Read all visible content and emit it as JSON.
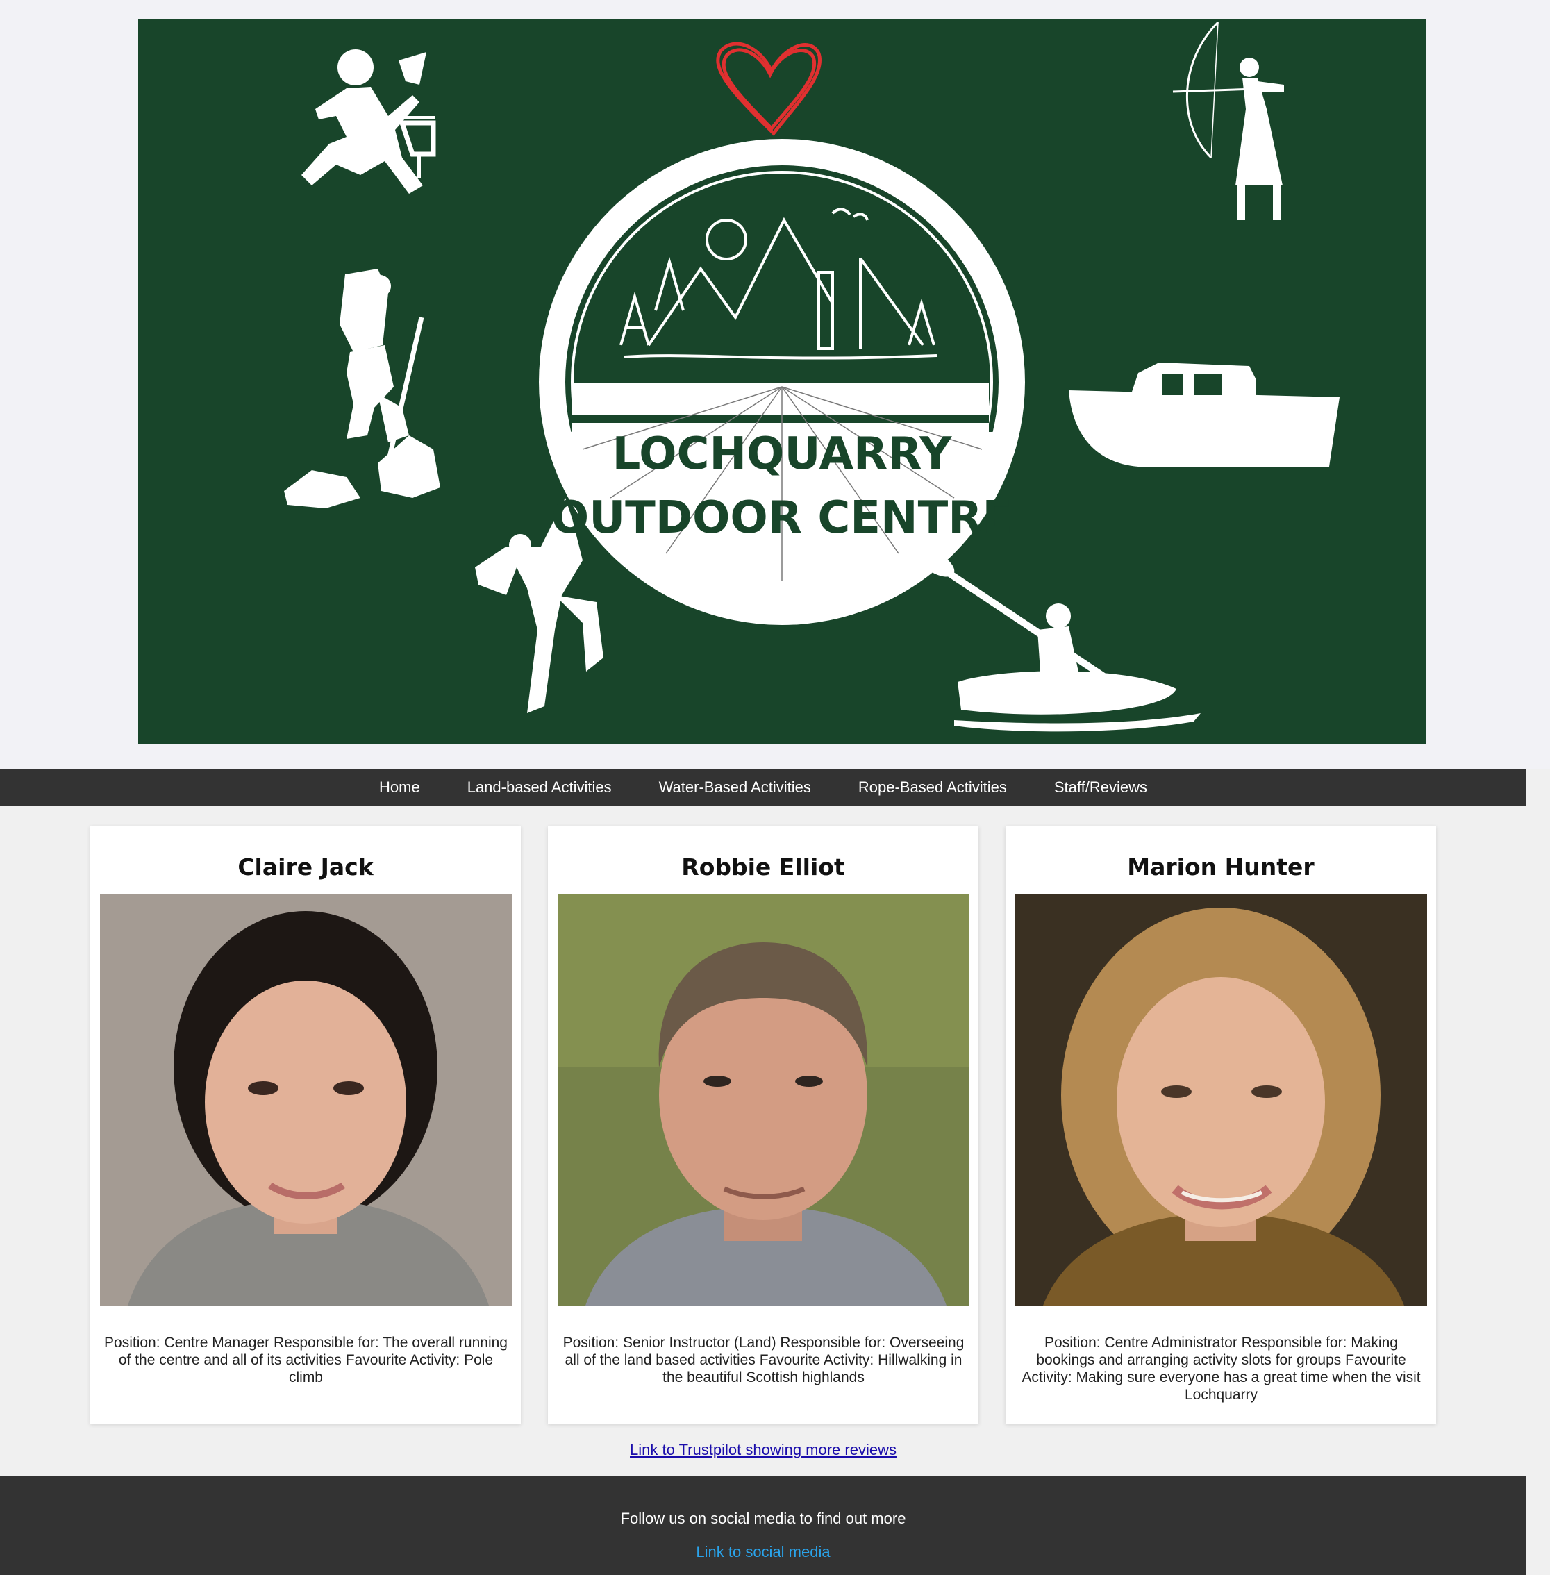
{
  "banner": {
    "logo_line1": "LOCHQUARRY",
    "logo_line2": "OUTDOOR CENTRE",
    "colors": {
      "background": "#18452a",
      "heart": "#e03030",
      "ink": "#ffffff"
    }
  },
  "nav": {
    "items": [
      {
        "label": "Home"
      },
      {
        "label": "Land-based Activities"
      },
      {
        "label": "Water-Based Activities"
      },
      {
        "label": "Rope-Based Activities"
      },
      {
        "label": "Staff/Reviews"
      }
    ]
  },
  "staff": [
    {
      "name": "Claire Jack",
      "description": "Position: Centre Manager Responsible for: The overall running of the centre and all of its activities Favourite Activity: Pole climb",
      "photo_bg": "#a49b93",
      "hair": "#1d1714"
    },
    {
      "name": "Robbie Elliot",
      "description": "Position: Senior Instructor (Land) Responsible for: Overseeing all of the land based activities Favourite Activity: Hillwalking in the beautiful Scottish highlands",
      "photo_bg": "#76824a",
      "hair": "#6b5a48"
    },
    {
      "name": "Marion Hunter",
      "description": "Position: Centre Administrator Responsible for: Making bookings and arranging activity slots for groups Favourite Activity: Making sure everyone has a great time when the visit Lochquarry",
      "photo_bg": "#3a3022",
      "hair": "#b48a52"
    }
  ],
  "trustpilot_link": "Link to Trustpilot showing more reviews",
  "footer": {
    "follow_text": "Follow us on social media to find out more",
    "social_link": "Link to social media"
  }
}
